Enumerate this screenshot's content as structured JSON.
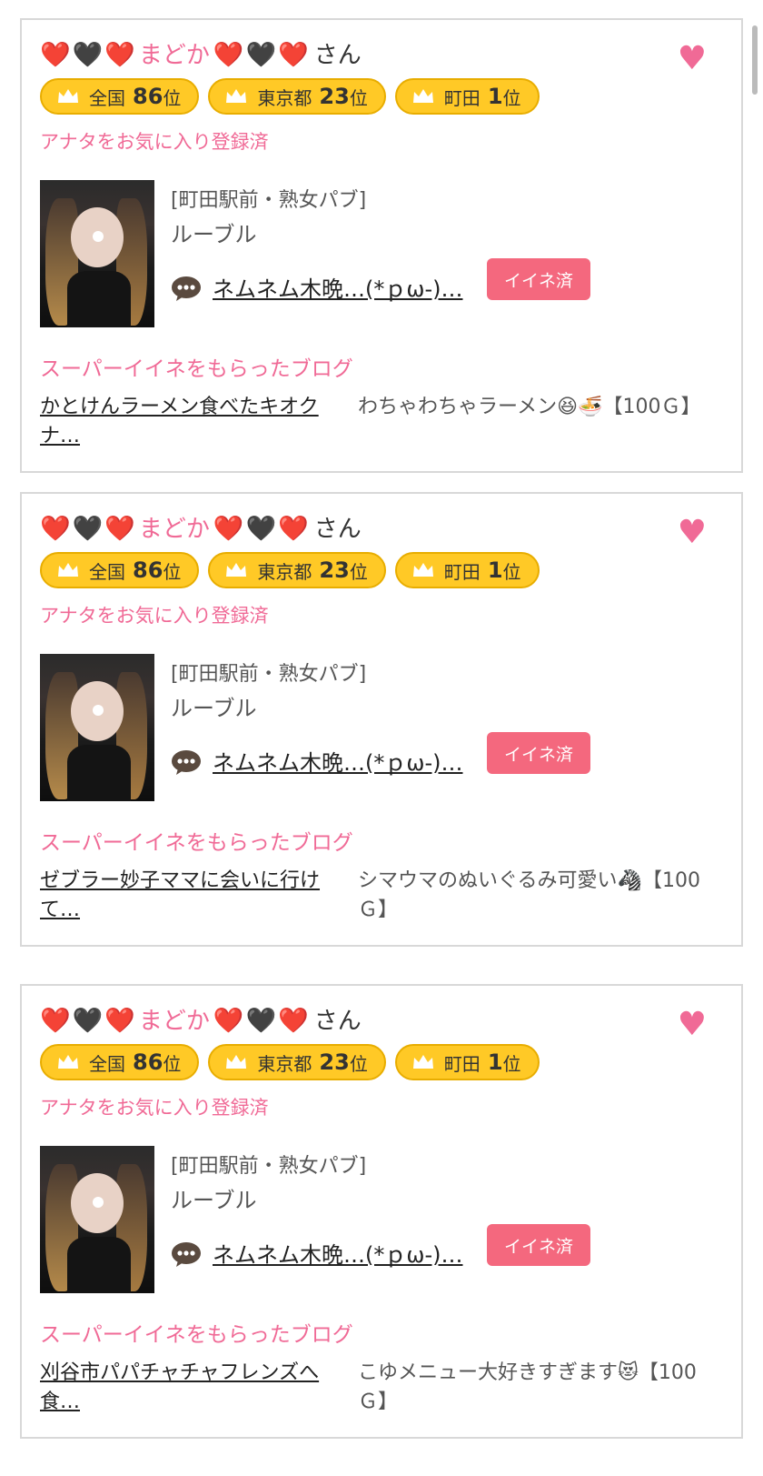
{
  "cards": [
    {
      "hearts": {
        "a": "❤️",
        "b": "🖤",
        "c": "❤️"
      },
      "name": "まどか",
      "san": "さん",
      "fav_icon": "♥",
      "badges": [
        {
          "label": "全国",
          "num": "86",
          "suf": "位"
        },
        {
          "label": "東京都",
          "num": "23",
          "suf": "位"
        },
        {
          "label": "町田",
          "num": "1",
          "suf": "位"
        }
      ],
      "fav_status": "アナタをお気に入り登録済",
      "shop_area": "[町田駅前・熟女パブ]",
      "shop_name": "ルーブル",
      "post": "ネムネム木晩…(*ｐω-)…",
      "like_btn": "イイネ済",
      "section_title": "スーパーイイネをもらったブログ",
      "blog_link": "かとけんラーメン食べたキオクナ…",
      "blog_desc": "わちゃわちゃラーメン😆🍜【100Ｇ】"
    },
    {
      "hearts": {
        "a": "❤️",
        "b": "🖤",
        "c": "❤️"
      },
      "name": "まどか",
      "san": "さん",
      "fav_icon": "♥",
      "badges": [
        {
          "label": "全国",
          "num": "86",
          "suf": "位"
        },
        {
          "label": "東京都",
          "num": "23",
          "suf": "位"
        },
        {
          "label": "町田",
          "num": "1",
          "suf": "位"
        }
      ],
      "fav_status": "アナタをお気に入り登録済",
      "shop_area": "[町田駅前・熟女パブ]",
      "shop_name": "ルーブル",
      "post": "ネムネム木晩…(*ｐω-)…",
      "like_btn": "イイネ済",
      "section_title": "スーパーイイネをもらったブログ",
      "blog_link": "ゼブラー妙子ママに会いに行けて…",
      "blog_desc": "シマウマのぬいぐるみ可愛い🦓【100Ｇ】"
    },
    {
      "hearts": {
        "a": "❤️",
        "b": "🖤",
        "c": "❤️"
      },
      "name": "まどか",
      "san": "さん",
      "fav_icon": "♥",
      "badges": [
        {
          "label": "全国",
          "num": "86",
          "suf": "位"
        },
        {
          "label": "東京都",
          "num": "23",
          "suf": "位"
        },
        {
          "label": "町田",
          "num": "1",
          "suf": "位"
        }
      ],
      "fav_status": "アナタをお気に入り登録済",
      "shop_area": "[町田駅前・熟女パブ]",
      "shop_name": "ルーブル",
      "post": "ネムネム木晩…(*ｐω-)…",
      "like_btn": "イイネ済",
      "section_title": "スーパーイイネをもらったブログ",
      "blog_link": "刈谷市パパチャチャフレンズへ食…",
      "blog_desc": "こゆメニュー大好きすぎます😻【100Ｇ】"
    }
  ],
  "colors": {
    "pink": "#f06a96",
    "badge": "#ffc926",
    "like": "#f4687e"
  }
}
